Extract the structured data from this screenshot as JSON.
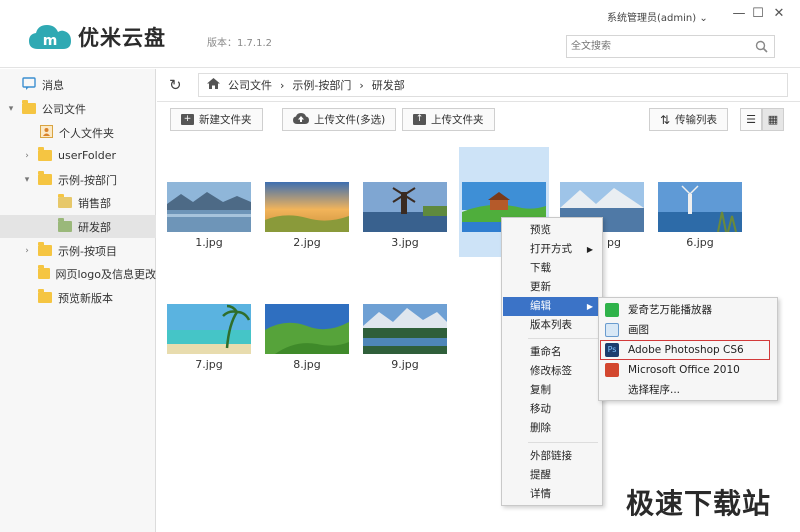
{
  "app": {
    "name": "优米云盘",
    "version": "版本：1.7.1.2",
    "user": "系统管理员(admin)",
    "search_placeholder": "全文搜索"
  },
  "sidebar": {
    "items": [
      {
        "label": "消息"
      },
      {
        "label": "公司文件"
      },
      {
        "label": "个人文件夹"
      },
      {
        "label": "userFolder"
      },
      {
        "label": "示例-按部门"
      },
      {
        "label": "销售部"
      },
      {
        "label": "研发部"
      },
      {
        "label": "示例-按项目"
      },
      {
        "label": "网页logo及信息更改"
      },
      {
        "label": "预览新版本"
      }
    ]
  },
  "breadcrumb": [
    "公司文件",
    "示例-按部门",
    "研发部"
  ],
  "toolbar": {
    "new_folder": "新建文件夹",
    "upload_files": "上传文件(多选)",
    "upload_folder": "上传文件夹",
    "transfer_list": "传输列表"
  },
  "files": [
    {
      "name": "1.jpg"
    },
    {
      "name": "2.jpg"
    },
    {
      "name": "3.jpg"
    },
    {
      "name": "4"
    },
    {
      "name": "pg"
    },
    {
      "name": "6.jpg"
    },
    {
      "name": "7.jpg"
    },
    {
      "name": "8.jpg"
    },
    {
      "name": "9.jpg"
    }
  ],
  "context_menu": {
    "items": [
      "预览",
      "打开方式",
      "下载",
      "更新",
      "编辑",
      "版本列表",
      "重命名",
      "修改标签",
      "复制",
      "移动",
      "删除",
      "外部链接",
      "提醒",
      "详情"
    ]
  },
  "submenu": {
    "items": [
      "爱奇艺万能播放器",
      "画图",
      "Adobe Photoshop CS6",
      "Microsoft Office 2010",
      "选择程序..."
    ]
  },
  "watermark": "极速下载站",
  "colors": {
    "accent": "#3b73c7",
    "brand": "#2fa9b3",
    "selection": "#cde3f7",
    "highlight_box": "#d23a3a"
  }
}
